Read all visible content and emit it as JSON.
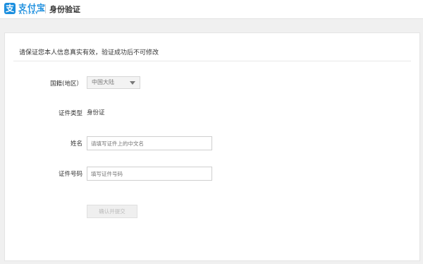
{
  "header": {
    "logo_icon_glyph": "支",
    "logo_text": "支付宝",
    "logo_sub": "ALIPAY",
    "page_title": "身份验证"
  },
  "form": {
    "notice": "请保证您本人信息真实有效，验证成功后不可修改",
    "nationality": {
      "label": "国籍(地区）",
      "value": "中国大陆"
    },
    "cert_type": {
      "label": "证件类型",
      "value": "身份证"
    },
    "name": {
      "label": "姓名",
      "placeholder": "请填写证件上的中文名"
    },
    "cert_number": {
      "label": "证件号码",
      "placeholder": "填写证件号码"
    },
    "submit_label": "确认并提交"
  },
  "colors": {
    "brand": "#1b8ede",
    "background": "#f0f0f0"
  }
}
